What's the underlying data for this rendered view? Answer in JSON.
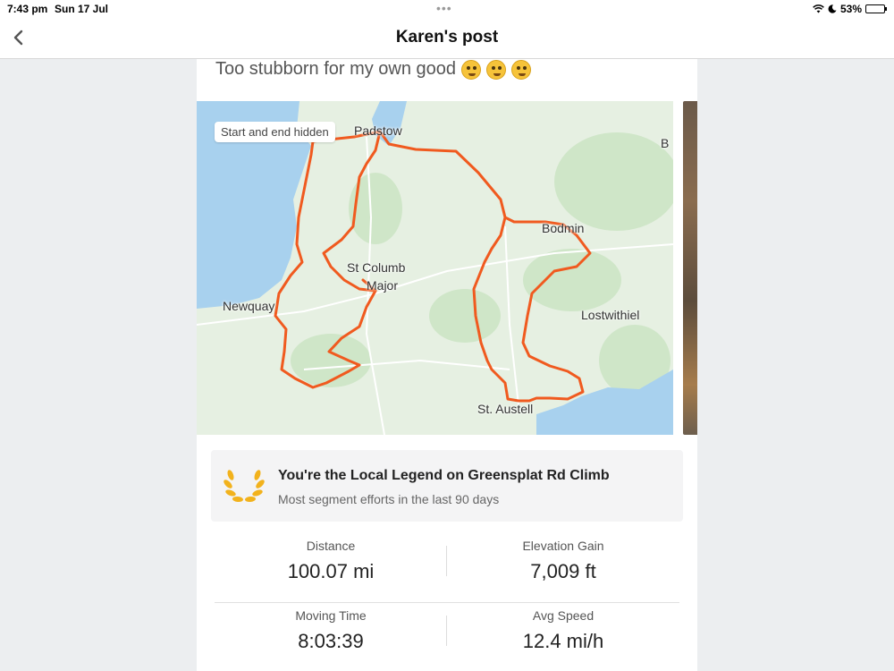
{
  "status_bar": {
    "time": "7:43 pm",
    "date": "Sun 17 Jul",
    "battery": "53%",
    "battery_level": 0.53
  },
  "nav": {
    "title": "Karen's post",
    "back_icon": "chevron-left-icon"
  },
  "post": {
    "caption": "Too stubborn for my own good",
    "emojis": [
      "flushed-face-icon",
      "zany-face-icon",
      "joy-face-icon"
    ]
  },
  "map": {
    "privacy_label": "Start and end hidden",
    "route_color": "#f05a1f",
    "places": {
      "padstow": "Padstow",
      "bodmin": "Bodmin",
      "st_columb": "St Columb",
      "major": "Major",
      "newquay": "Newquay",
      "lostwithiel": "Lostwithiel",
      "st_austell": "St. Austell",
      "edge": "B"
    }
  },
  "legend": {
    "title": "You're the Local Legend on Greensplat Rd Climb",
    "subtitle": "Most segment efforts in the last 90 days",
    "icon": "laurel-icon",
    "accent": "#f2b21c"
  },
  "stats": [
    {
      "label": "Distance",
      "value": "100.07 mi"
    },
    {
      "label": "Elevation Gain",
      "value": "7,009 ft"
    },
    {
      "label": "Moving Time",
      "value": "8:03:39"
    },
    {
      "label": "Avg Speed",
      "value": "12.4 mi/h"
    }
  ]
}
